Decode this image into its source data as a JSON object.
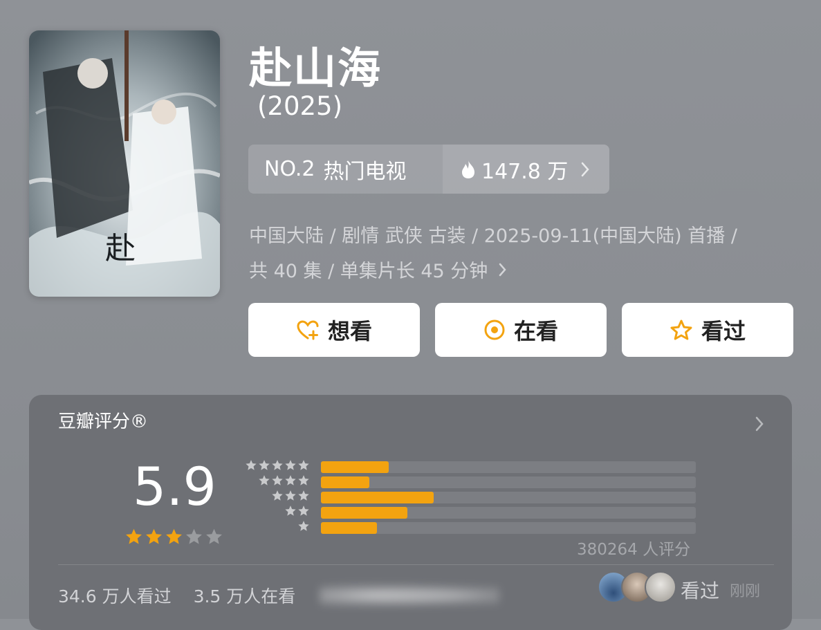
{
  "show": {
    "title": "赴山海",
    "year": "(2025)"
  },
  "ranking": {
    "position": "NO.2",
    "category": "热门电视",
    "heat": "147.8 万"
  },
  "meta": {
    "line1": "中国大陆 / 剧情 武侠 古装 / 2025-09-11(中国大陆) 首播 /",
    "line2": "共 40 集 / 单集片长 45 分钟"
  },
  "actions": {
    "want": "想看",
    "watching": "在看",
    "watched": "看过"
  },
  "rating": {
    "label": "豆瓣评分®",
    "score": "5.9",
    "stars_filled": 3,
    "stars_total": 5,
    "distribution_relative": [
      0.18,
      0.13,
      0.3,
      0.23,
      0.15
    ],
    "rating_count": "380264 人评分"
  },
  "stats": {
    "watched": "34.6 万人看过",
    "watching": "3.5 万人在看"
  },
  "recent": {
    "action": "看过",
    "time": "刚刚"
  },
  "colors": {
    "accent": "#f3a310",
    "background": "#8c8f94",
    "card": "#6e7075"
  },
  "icons": {
    "heat": "flame-icon",
    "want": "heart-plus-icon",
    "watching": "target-icon",
    "watched": "star-outline-icon",
    "more": "chevron-right-icon"
  }
}
